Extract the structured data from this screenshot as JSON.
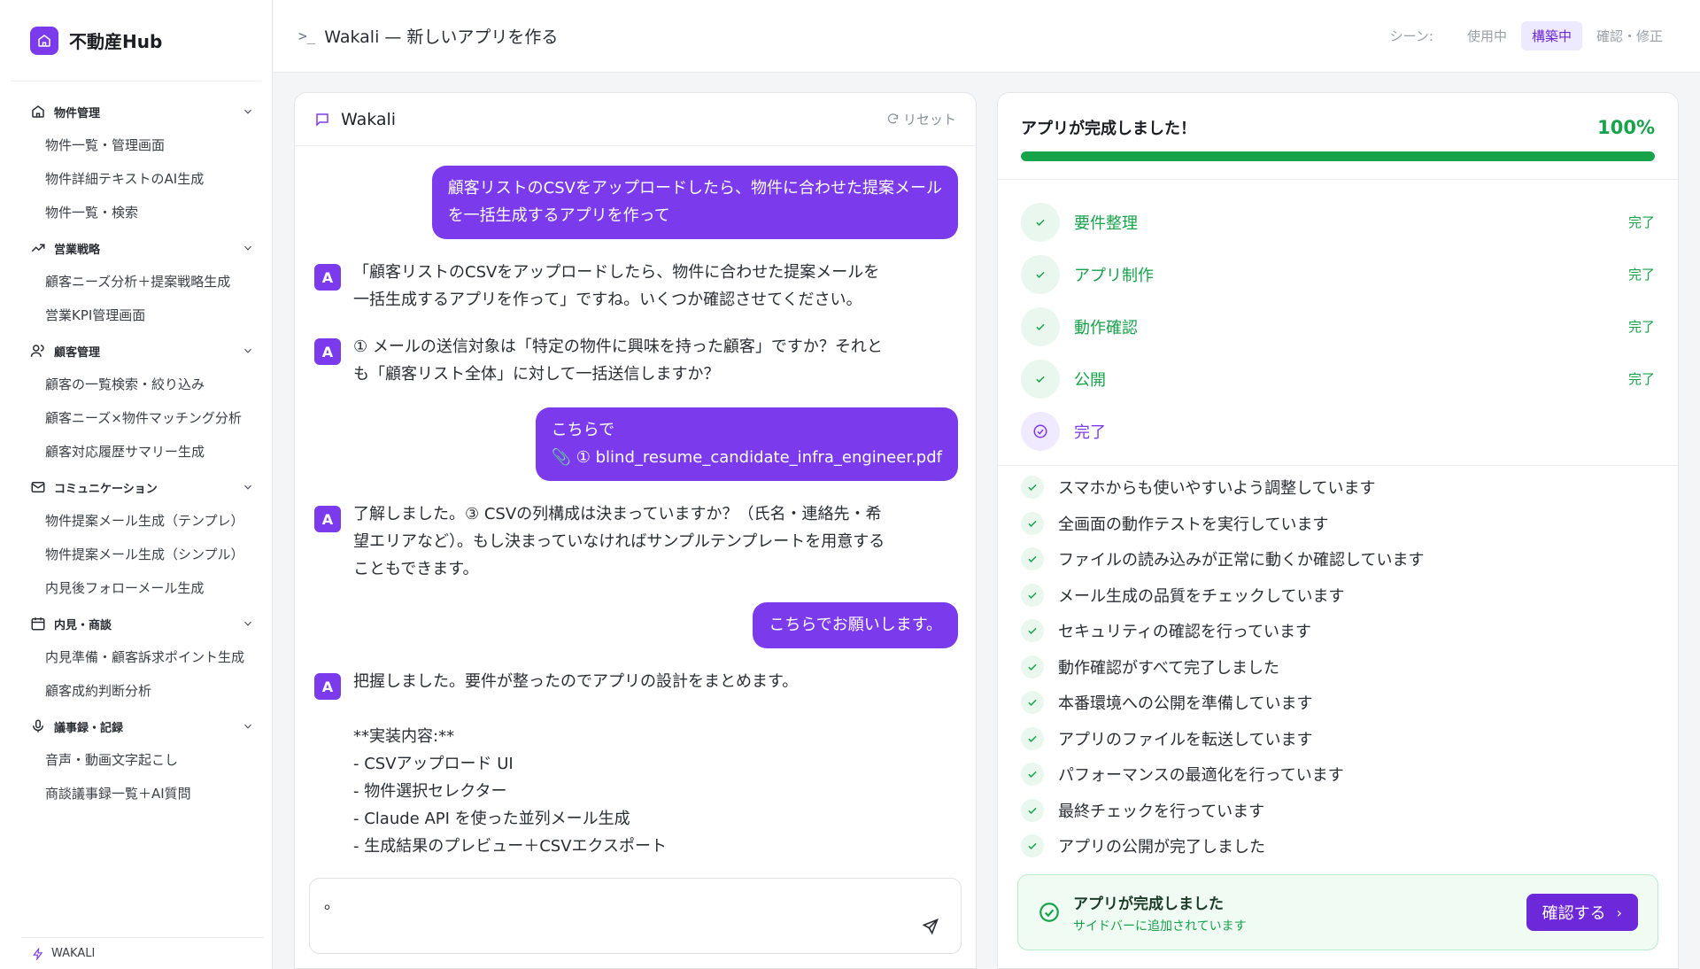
{
  "brand": {
    "name": "不動産Hub"
  },
  "sidebar": {
    "sections": [
      {
        "title": "物件管理",
        "icon": "home-icon",
        "items": [
          "物件一覧・管理画面",
          "物件詳細テキストのAI生成",
          "物件一覧・検索"
        ]
      },
      {
        "title": "営業戦略",
        "icon": "trend-icon",
        "items": [
          "顧客ニーズ分析＋提案戦略生成",
          "営業KPI管理画面"
        ]
      },
      {
        "title": "顧客管理",
        "icon": "users-icon",
        "items": [
          "顧客の一覧検索・絞り込み",
          "顧客ニーズ×物件マッチング分析",
          "顧客対応履歴サマリー生成"
        ]
      },
      {
        "title": "コミュニケーション",
        "icon": "mail-icon",
        "items": [
          "物件提案メール生成（テンプレ）",
          "物件提案メール生成（シンプル）",
          "内見後フォローメール生成"
        ]
      },
      {
        "title": "内見・商談",
        "icon": "calendar-icon",
        "items": [
          "内見準備・顧客訴求ポイント生成",
          "顧客成約判断分析"
        ]
      },
      {
        "title": "議事録・記録",
        "icon": "mic-icon",
        "items": [
          "音声・動画文字起こし",
          "商談議事録一覧＋AI質問"
        ]
      }
    ],
    "footer": "WAKALI"
  },
  "header": {
    "title": "Wakali — 新しいアプリを作る",
    "scene_label": "シーン:",
    "scene_options": [
      "使用中",
      "構築中",
      "確認・修正"
    ],
    "scene_active": "構築中"
  },
  "chat": {
    "title": "Wakali",
    "reset_label": "リセット",
    "messages": [
      {
        "role": "user",
        "text": "顧客リストのCSVをアップロードしたら、物件に合わせた提案メール\nを一括生成するアプリを作って"
      },
      {
        "role": "assistant",
        "avatar": "A",
        "text": "「顧客リストのCSVをアップロードしたら、物件に合わせた提案メールを\n一括生成するアプリを作って」ですね。いくつか確認させてください。"
      },
      {
        "role": "assistant",
        "avatar": "A",
        "text": "① メールの送信対象は「特定の物件に興味を持った顧客」ですか？それと\nも「顧客リスト全体」に対して一括送信しますか？"
      },
      {
        "role": "user",
        "text": "こちらで\n📎 ① blind_resume_candidate_infra_engineer.pdf"
      },
      {
        "role": "assistant",
        "avatar": "A",
        "text": "了解しました。③ CSVの列構成は決まっていますか？（氏名・連絡先・希\n望エリアなど）。もし決まっていなければサンプルテンプレートを用意する\nこともできます。"
      },
      {
        "role": "user",
        "text": "こちらでお願いします。"
      },
      {
        "role": "assistant",
        "avatar": "A",
        "text": "把握しました。要件が整ったのでアプリの設計をまとめます。\n\n**実装内容:**\n- CSVアップロード UI\n- 物件選択セレクター\n- Claude API を使った並列メール生成\n- 生成結果のプレビュー＋CSVエクスポート"
      }
    ],
    "composer_value": "。"
  },
  "progress": {
    "title": "アプリが完成しました！",
    "percent_label": "100%",
    "percent": 100,
    "steps": [
      {
        "label": "要件整理",
        "status": "完了"
      },
      {
        "label": "アプリ制作",
        "status": "完了"
      },
      {
        "label": "動作確認",
        "status": "完了"
      },
      {
        "label": "公開",
        "status": "完了"
      },
      {
        "label": "完了",
        "status": ""
      }
    ],
    "logs": [
      "スマホからも使いやすいよう調整しています",
      "全画面の動作テストを実行しています",
      "ファイルの読み込みが正常に動くか確認しています",
      "メール生成の品質をチェックしています",
      "セキュリティの確認を行っています",
      "動作確認がすべて完了しました",
      "本番環境への公開を準備しています",
      "アプリのファイルを転送しています",
      "パフォーマンスの最適化を行っています",
      "最終チェックを行っています",
      "アプリの公開が完了しました"
    ],
    "done_card": {
      "title": "アプリが完成しました",
      "subtitle": "サイドバーに追加されています",
      "button": "確認する"
    }
  },
  "colors": {
    "accent": "#7c3aed",
    "success": "#16a34a"
  }
}
